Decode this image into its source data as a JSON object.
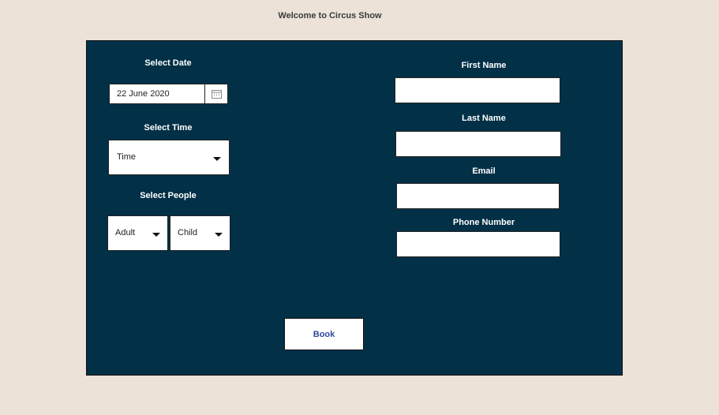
{
  "header": {
    "title": "Welcome to  Circus Show"
  },
  "form": {
    "date_label": "Select Date",
    "date_value": "22 June 2020",
    "time_label": "Select Time",
    "time_value": "Time",
    "people_label": "Select People",
    "adult_value": "Adult",
    "child_value": "Child",
    "first_name_label": "First Name",
    "last_name_label": "Last Name",
    "email_label": "Email",
    "phone_label": "Phone Number",
    "book_label": "Book"
  }
}
